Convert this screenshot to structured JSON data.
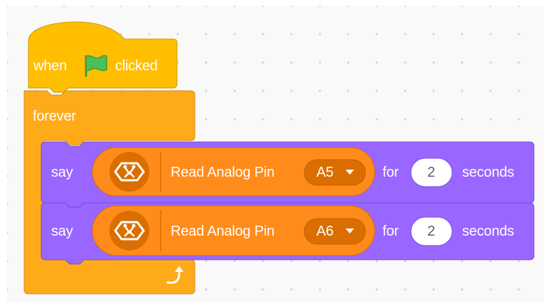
{
  "colors": {
    "events": "#ffbf00",
    "control": "#ffab19",
    "looks": "#9966ff",
    "extension": "#ff8c1a",
    "dropdown": "#db6e00",
    "flag": "#4cbf56",
    "canvas": "#f9f9f9"
  },
  "hat_block": {
    "when_label": "when",
    "flag_icon": "green-flag-icon",
    "clicked_label": "clicked"
  },
  "forever_block": {
    "label": "forever",
    "loop_icon": "loop-arrow-icon"
  },
  "say_blocks": [
    {
      "say_label": "say",
      "reporter": {
        "icon": "arduino-extension-icon",
        "label": "Read Analog Pin",
        "pin": "A5"
      },
      "for_label": "for",
      "duration": "2",
      "seconds_label": "seconds"
    },
    {
      "say_label": "say",
      "reporter": {
        "icon": "arduino-extension-icon",
        "label": "Read Analog Pin",
        "pin": "A6"
      },
      "for_label": "for",
      "duration": "2",
      "seconds_label": "seconds"
    }
  ]
}
